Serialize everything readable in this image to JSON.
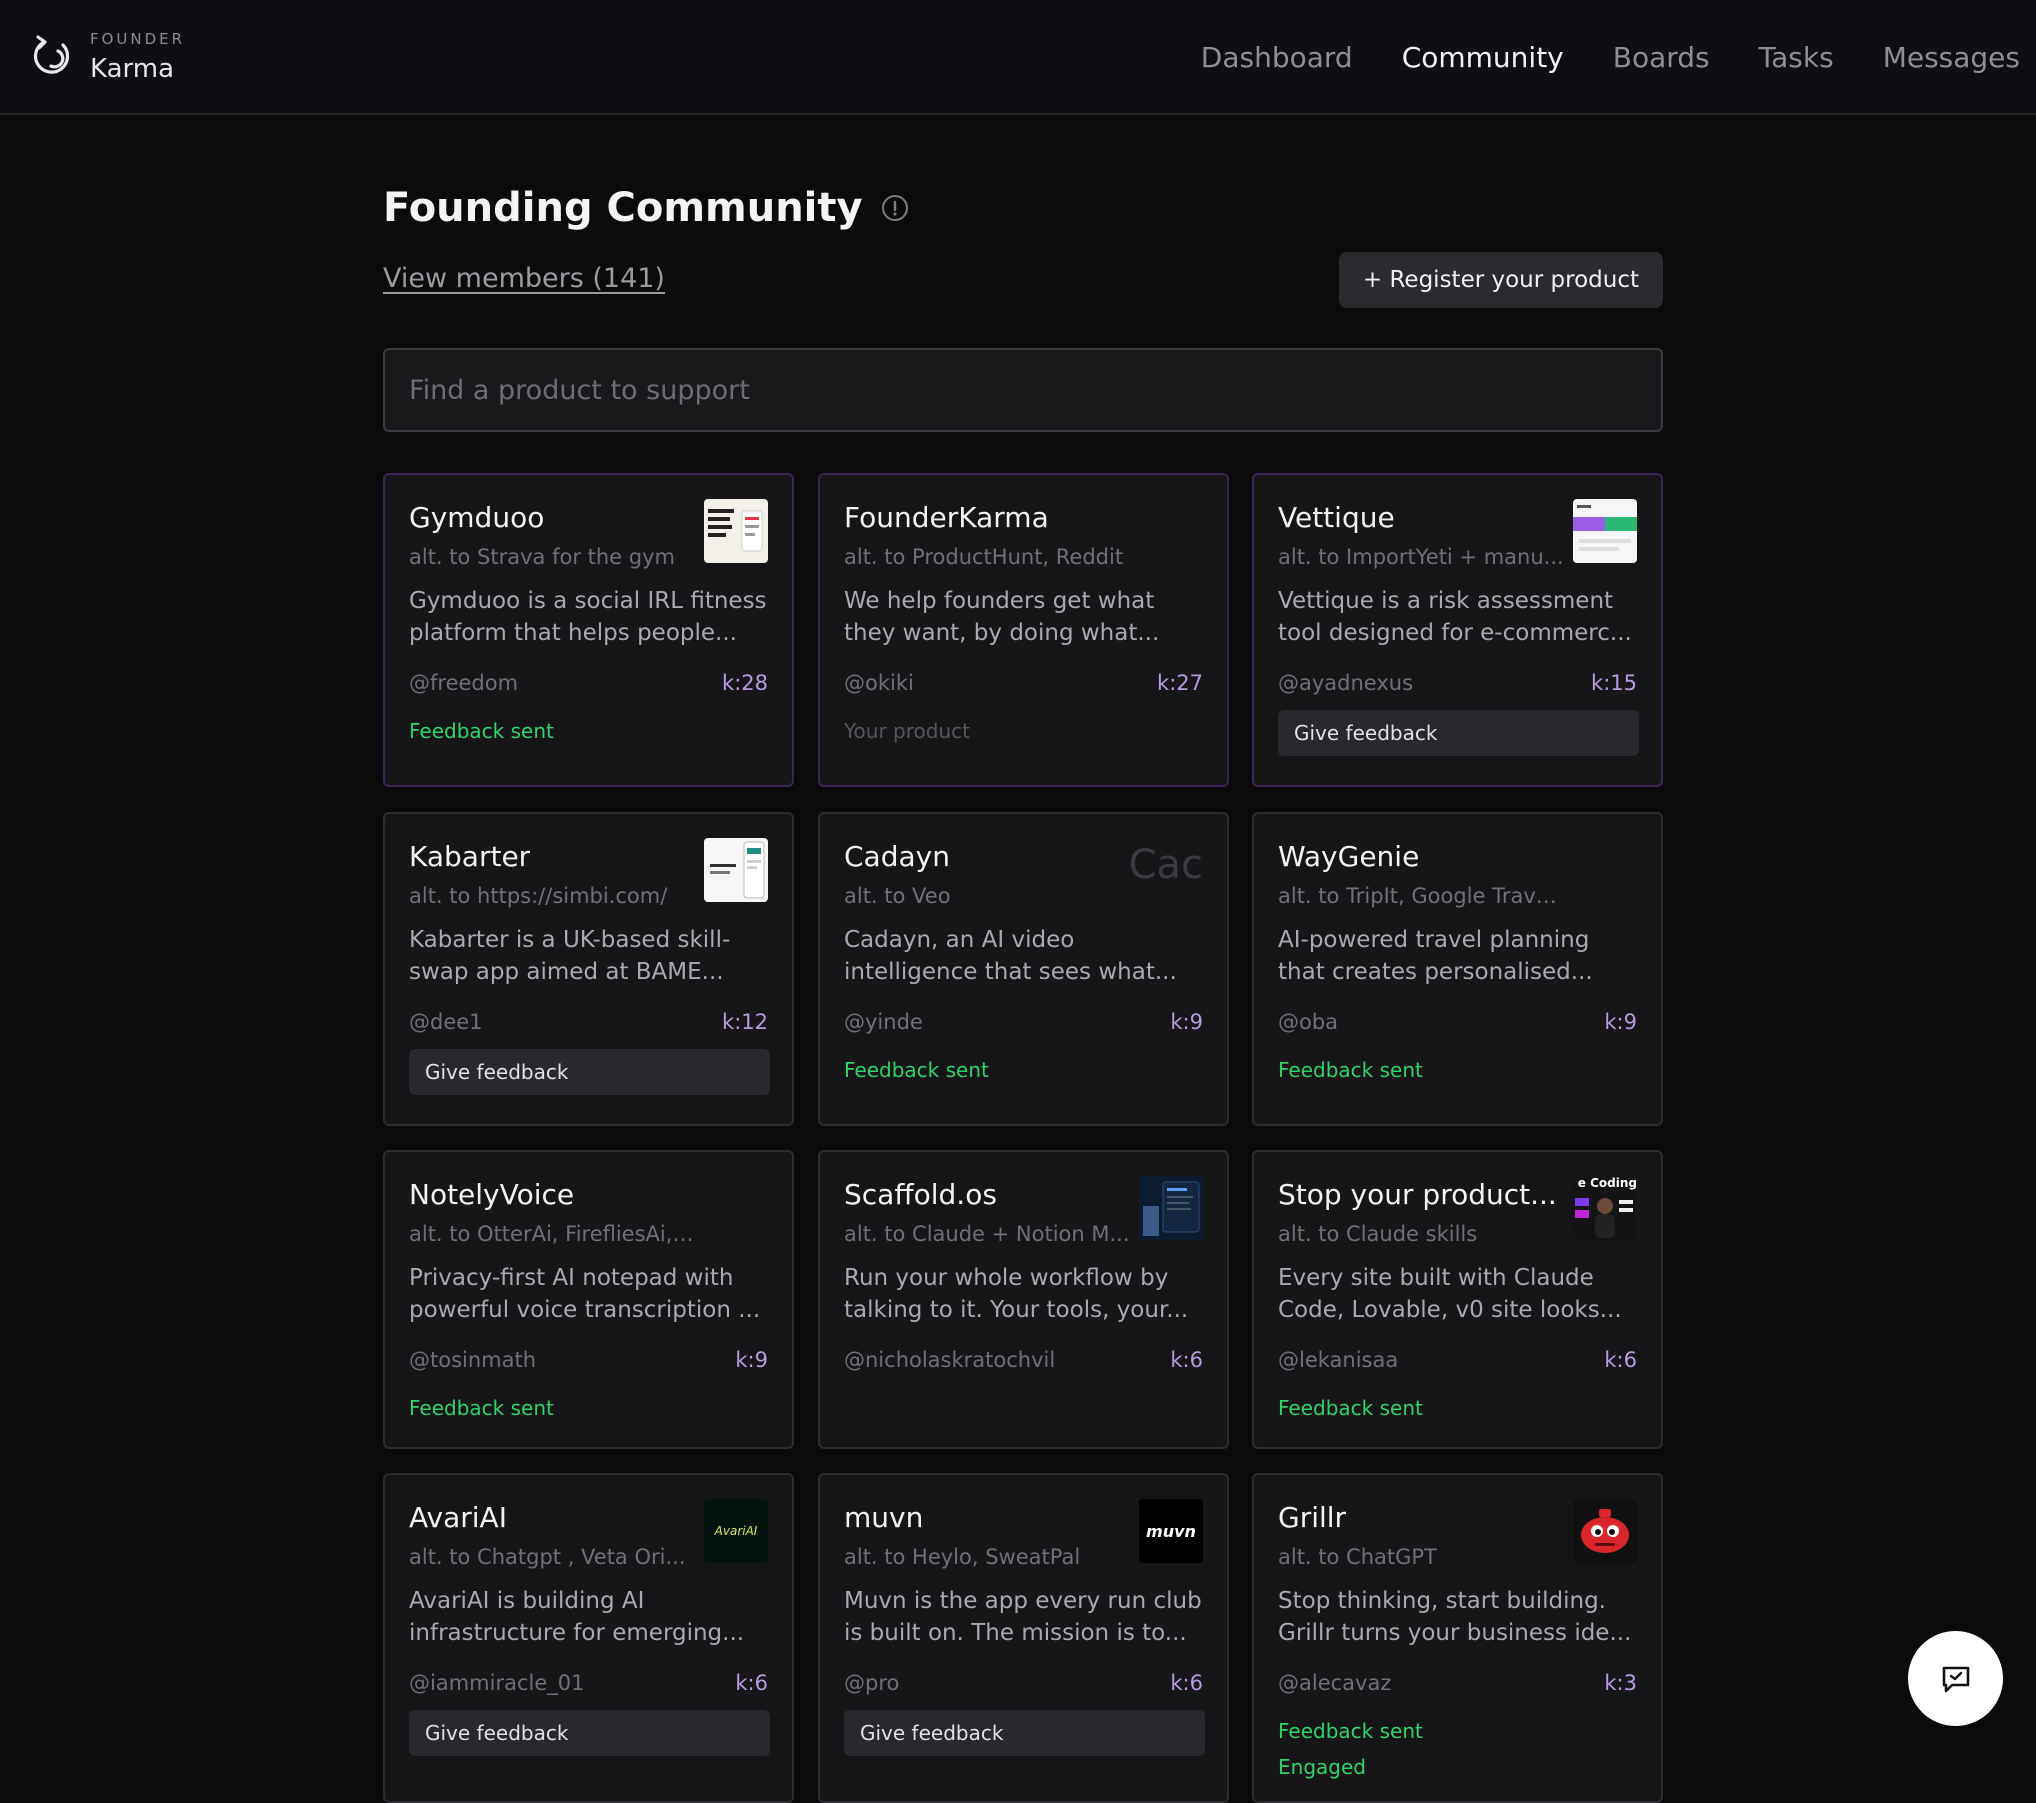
{
  "brand": {
    "small": "FOUNDER",
    "name": "Karma"
  },
  "nav": {
    "items": [
      {
        "label": "Dashboard"
      },
      {
        "label": "Community"
      },
      {
        "label": "Boards"
      },
      {
        "label": "Tasks"
      },
      {
        "label": "Messages"
      }
    ],
    "active": "Community"
  },
  "page": {
    "title": "Founding Community",
    "view_members": "View members (141)",
    "register_label": "+ Register your product",
    "search_placeholder": "Find a product to support"
  },
  "colors": {
    "accent_green": "#2fd36a",
    "karma_purple": "#b89ae0",
    "featured_border": "#3c2456"
  },
  "products": [
    {
      "name": "Gymduoo",
      "alt": "alt. to Strava for the gym",
      "desc1": "Gymduoo is a social IRL fitness",
      "desc2": "platform that helps people...",
      "user": "@freedom",
      "karma": "k:28",
      "status": "Feedback sent",
      "thumb": "thumb-gymduoo"
    },
    {
      "name": "FounderKarma",
      "alt": "alt. to ProductHunt, Reddit",
      "desc1": "We help founders get what",
      "desc2": "they want, by doing what...",
      "user": "@okiki",
      "karma": "k:27",
      "status": "Your product",
      "thumb": ""
    },
    {
      "name": "Vettique",
      "alt": "alt. to ImportYeti + manu...",
      "desc1": "Vettique is a risk assessment",
      "desc2": "tool designed for e-commerc...",
      "user": "@ayadnexus",
      "karma": "k:15",
      "action": "Give feedback",
      "thumb": "thumb-vettique"
    },
    {
      "name": "Kabarter",
      "alt": "alt. to https://simbi.com/",
      "desc1": "Kabarter is a UK-based skill-",
      "desc2": "swap app aimed at BAME...",
      "user": "@dee1",
      "karma": "k:12",
      "action": "Give feedback",
      "thumb": "thumb-kabarter"
    },
    {
      "name": "Cadayn",
      "alt": "alt. to Veo",
      "desc1": "Cadayn, an AI video",
      "desc2": "intelligence that sees what...",
      "user": "@yinde",
      "karma": "k:9",
      "status": "Feedback sent",
      "thumb_text": "Cac"
    },
    {
      "name": "WayGenie",
      "alt": "alt. to TripIt, Google Travel, Chat...",
      "desc1": "AI-powered travel planning",
      "desc2": "that creates personalised...",
      "user": "@oba",
      "karma": "k:9",
      "status": "Feedback sent",
      "thumb": ""
    },
    {
      "name": "NotelyVoice",
      "alt": "alt. to OtterAi, FirefliesAi, NottaAi",
      "desc1": "Privacy-first AI notepad with",
      "desc2": "powerful voice transcription ...",
      "user": "@tosinmath",
      "karma": "k:9",
      "status": "Feedback sent",
      "thumb": ""
    },
    {
      "name": "Scaffold.os",
      "alt": "alt. to Claude + Notion M...",
      "desc1": "Run your whole workflow by",
      "desc2": "talking to it. Your tools, your...",
      "user": "@nicholaskratochvil",
      "karma": "k:6",
      "thumb": "thumb-scaffold"
    },
    {
      "name": "Stop your product...",
      "alt": "alt. to Claude skills",
      "desc1": "Every site built with Claude",
      "desc2": "Code, Lovable, v0 site looks...",
      "user": "@lekanisaa",
      "karma": "k:6",
      "status": "Feedback sent",
      "thumb": "thumb-stop",
      "thumb_caption": "e Coding"
    },
    {
      "name": "AvariAI",
      "alt": "alt. to Chatgpt , Veta Ori...",
      "desc1": "AvariAI is building AI",
      "desc2": "infrastructure for emerging...",
      "user": "@iammiracle_01",
      "karma": "k:6",
      "action": "Give feedback",
      "thumb": "thumb-avari",
      "thumb_caption": "AvariAI"
    },
    {
      "name": "muvn",
      "alt": "alt. to Heylo, SweatPal",
      "desc1": "Muvn is the app every run club",
      "desc2": "is built on. The mission is to...",
      "user": "@pro",
      "karma": "k:6",
      "action": "Give feedback",
      "thumb": "thumb-muvn",
      "thumb_caption": "muvn"
    },
    {
      "name": "Grillr",
      "alt": "alt. to ChatGPT",
      "desc1": "Stop thinking, start building.",
      "desc2": "Grillr turns your business ide...",
      "user": "@alecavaz",
      "karma": "k:3",
      "status": "Feedback sent",
      "status2": "Engaged",
      "thumb": "thumb-grillr"
    }
  ]
}
